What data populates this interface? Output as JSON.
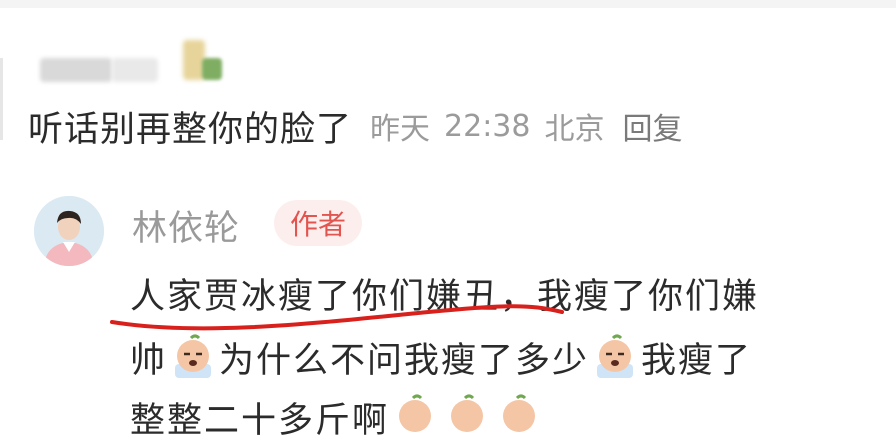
{
  "comment": {
    "text": "听话别再整你的脸了",
    "date": "昨天",
    "time": "22:38",
    "location": "北京",
    "reply_label": "回复"
  },
  "author_reply": {
    "name": "林依轮",
    "badge": "作者",
    "line1": "人家贾冰瘦了你们嫌丑，我瘦了你们嫌",
    "line2_a": "帅",
    "line2_b": "为什么不问我瘦了多少",
    "line2_c": "我瘦了",
    "line3": "整整二十多斤啊"
  },
  "colors": {
    "underline": "#d8201c",
    "badge_text": "#e2544f",
    "badge_bg": "#fdeeee",
    "meta_text": "#9b9b9b"
  },
  "icons": [
    "crying-emoji-icon",
    "crying-emoji-icon",
    "crying-emoji-icon",
    "crying-emoji-icon",
    "crying-emoji-icon"
  ]
}
